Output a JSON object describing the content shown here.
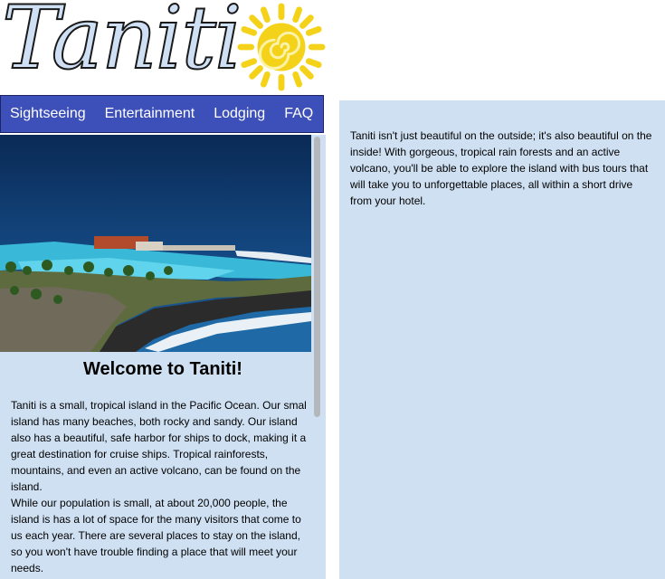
{
  "logo": {
    "text": "Taniti",
    "icon": "sun-icon"
  },
  "nav": {
    "items": [
      {
        "label": "Sightseeing"
      },
      {
        "label": "Entertainment"
      },
      {
        "label": "Lodging"
      },
      {
        "label": "FAQ"
      }
    ]
  },
  "main": {
    "hero_image": "coastal-resort-photo",
    "heading": "Welcome to Taniti!",
    "paragraph_1": "Taniti is a small, tropical island in the Pacific Ocean.  Our smal island has many beaches, both rocky and sandy.  Our island also has a beautiful, safe harbor for ships to dock, making it a great destination for cruise ships.  Tropical rainforests, mountains, and even an active volcano, can be found on the island.",
    "paragraph_2": "While our population is small, at about 20,000 people, the island is has a lot of space for the many visitors that come to us each year.  There are several places to stay on the island, so you won't have trouble finding a place that will meet your needs."
  },
  "aside": {
    "text": "Taniti isn't just beautiful on the outside; it's also beautiful on the inside!  With gorgeous, tropical rain forests and an active volcano, you'll be able to explore the island with bus tours that will take you to unforgettable places, all within a short drive from your hotel."
  },
  "colors": {
    "nav_background": "#3d4fb8",
    "panel_background": "#cfe0f2",
    "logo_fill": "#cfe0f4",
    "sun": "#f5d21a"
  }
}
